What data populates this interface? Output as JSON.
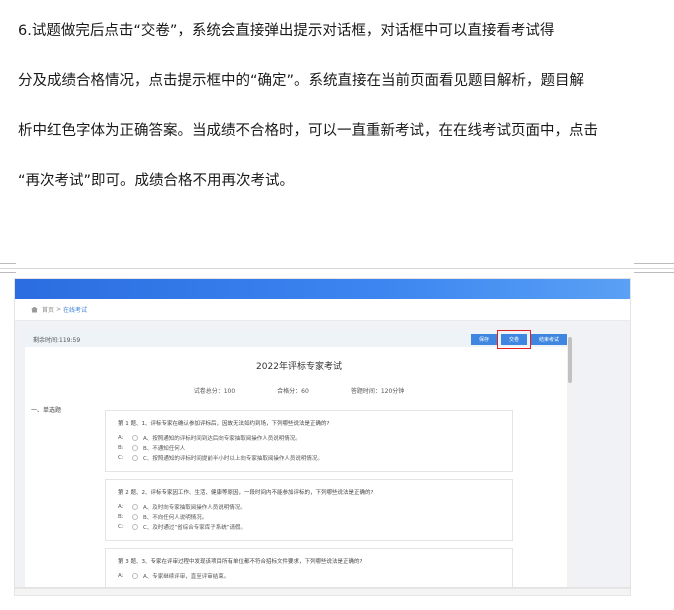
{
  "document": {
    "lines": [
      "6.试题做完后点击“交卷”，系统会直接弹出提示对话框，对话框中可以直接看考试得",
      "分及成绩合格情况，点击提示框中的“确定”。系统直接在当前页面看见题目解析，题目解",
      "析中红色字体为正确答案。当成绩不合格时，可以一直重新考试，在在线考试页面中，点击",
      "“再次考试”即可。成绩合格不用再次考试。"
    ]
  },
  "screenshot": {
    "breadcrumb": {
      "home": "首页",
      "separator": ">",
      "current": "在线考试"
    },
    "timer": "剩余时间:119:59",
    "buttons": {
      "save": "保存",
      "submit": "交卷",
      "finish": "结束考试"
    },
    "exam": {
      "title": "2022年评标专家考试",
      "total_score": "试卷总分：100",
      "pass_score": "合格分：60",
      "duration": "答题时间：120分钟",
      "section": "一、单选题"
    },
    "questions": [
      {
        "text": "第 1 题、1、评标专家在确认参加评标后，因故无法如约到场，下列哪些说法是正确的?",
        "options": [
          {
            "letter": "A:",
            "text": "A、按照通知的评标时间到达后向专家抽取阅操作人员说明情况。"
          },
          {
            "letter": "B:",
            "text": "B、不通知任何人"
          },
          {
            "letter": "C:",
            "text": "C、按照通知的评标时间提前半小时以上向专家抽取阅操作人员说明情况。"
          }
        ]
      },
      {
        "text": "第 2 题、2、评标专家因工作、生活、健康等原因，一段时间内不能参加评标的，下列哪些说法是正确的?",
        "options": [
          {
            "letter": "A:",
            "text": "A、及时向专家抽取阅操作人员说明情况。"
          },
          {
            "letter": "B:",
            "text": "B、不向任何人说明情况。"
          },
          {
            "letter": "C:",
            "text": "C、及时通过“省综合专家库子系统”请假。"
          }
        ]
      },
      {
        "text": "第 3 题、3、专家在评审过程中发现该项目所有单位都不符合招标文件要求，下列哪些说法是正确的?",
        "options": [
          {
            "letter": "A:",
            "text": "A、专家继续评审，直至评审结束。"
          }
        ]
      }
    ]
  }
}
